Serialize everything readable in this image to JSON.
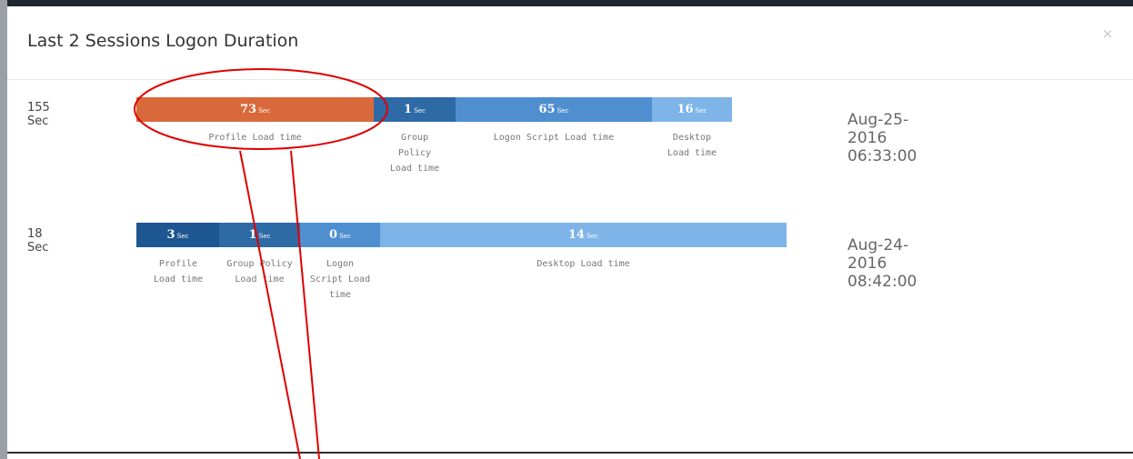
{
  "modal": {
    "title": "Last 2 Sessions Logon Duration",
    "close_icon": "×"
  },
  "unit_label": "Sec",
  "sessions": [
    {
      "total": "155 Sec",
      "timestamp": "Aug-25-2016 06:33:00",
      "segments": [
        {
          "value": "73",
          "label": "Profile Load time",
          "color": "#d9693a"
        },
        {
          "value": "1",
          "label": "Group Policy Load time",
          "color": "#2e6aa6"
        },
        {
          "value": "65",
          "label": "Logon Script Load time",
          "color": "#4f8fcf"
        },
        {
          "value": "16",
          "label": "Desktop Load time",
          "color": "#7eb4e8"
        }
      ]
    },
    {
      "total": "18 Sec",
      "timestamp": "Aug-24-2016 08:42:00",
      "segments": [
        {
          "value": "3",
          "label": "Profile Load time",
          "color": "#1d5690"
        },
        {
          "value": "1",
          "label": "Group Policy Load time",
          "color": "#2e6aa6"
        },
        {
          "value": "0",
          "label": "Logon Script Load time",
          "color": "#4f8fcf"
        },
        {
          "value": "14",
          "label": "Desktop Load time",
          "color": "#7eb4e8"
        }
      ]
    }
  ],
  "annotation": {
    "color": "#e00000"
  }
}
